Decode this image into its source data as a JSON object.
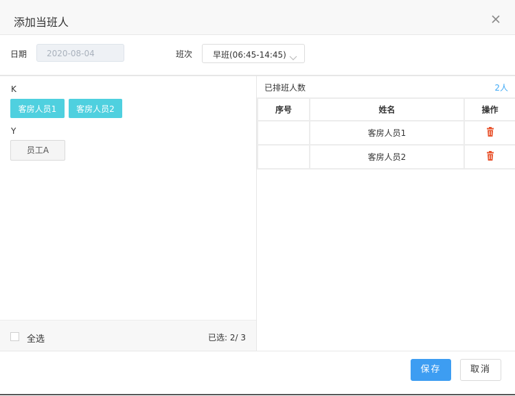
{
  "dialog": {
    "title": "添加当班人",
    "close_icon": "close-icon"
  },
  "form": {
    "date_label": "日期",
    "date_value": "2020-08-04",
    "shift_label": "班次",
    "shift_value": "早班(06:45-14:45)"
  },
  "left": {
    "groups": [
      {
        "label": "K",
        "items": [
          {
            "label": "客房人员1",
            "selected": true
          },
          {
            "label": "客房人员2",
            "selected": true
          }
        ]
      },
      {
        "label": "Y",
        "items": [
          {
            "label": "员工A",
            "selected": false
          }
        ]
      }
    ],
    "select_all_label": "全选",
    "selected_count": "已选: 2/ 3"
  },
  "right": {
    "title": "已排班人数",
    "count": "2人",
    "columns": [
      "序号",
      "姓名",
      "操作"
    ],
    "rows": [
      {
        "index": "",
        "name": "客房人员1",
        "action_icon": "trash-icon"
      },
      {
        "index": "",
        "name": "客房人员2",
        "action_icon": "trash-icon"
      }
    ]
  },
  "buttons": {
    "save": "保存",
    "cancel": "取消"
  },
  "colors": {
    "accent": "#3d9df2",
    "tag_selected": "#4fd0df",
    "delete": "#e8502a",
    "count_blue": "#3fa9f5"
  }
}
